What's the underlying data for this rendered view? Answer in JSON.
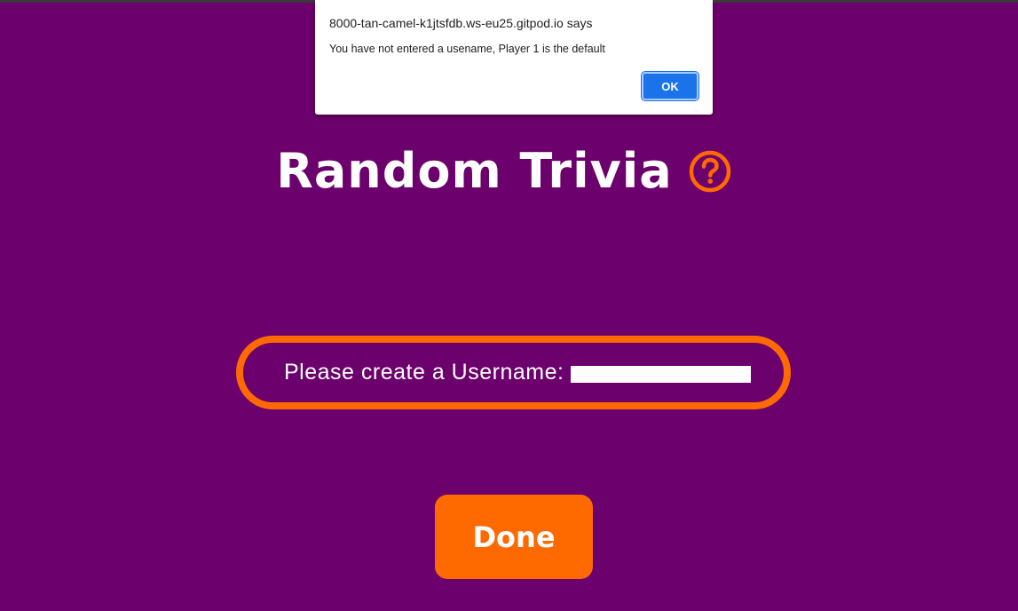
{
  "colors": {
    "background": "#6c006c",
    "accent": "#ff6a00",
    "dialog_button": "#1a73e8"
  },
  "header": {
    "title": "Random Trivia",
    "help_icon": "question-circle-icon"
  },
  "form": {
    "username_label": "Please create a Username:",
    "username_value": ""
  },
  "actions": {
    "done_label": "Done"
  },
  "alert_dialog": {
    "title": "8000-tan-camel-k1jtsfdb.ws-eu25.gitpod.io says",
    "message": "You have not entered a usename, Player 1 is the default",
    "ok_label": "OK"
  }
}
